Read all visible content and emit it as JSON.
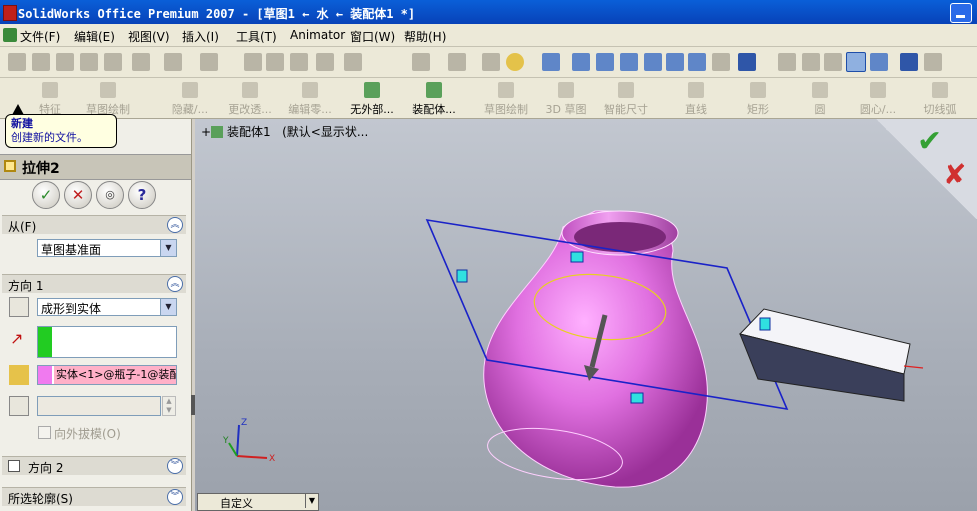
{
  "window": {
    "title": "SolidWorks Office Premium 2007 - [草图1 ← 水 ← 装配体1 *]"
  },
  "menu": [
    {
      "label": "文件(F)"
    },
    {
      "label": "编辑(E)"
    },
    {
      "label": "视图(V)"
    },
    {
      "label": "插入(I)"
    },
    {
      "label": "工具(T)"
    },
    {
      "label": "Animator"
    },
    {
      "label": "窗口(W)"
    },
    {
      "label": "帮助(H)"
    }
  ],
  "toolbar2": {
    "items": [
      "特征",
      "草图绘制",
      "隐藏/...",
      "更改透...",
      "编辑零...",
      "无外部...",
      "装配体...",
      "草图绘制",
      "3D 草图",
      "智能尺寸",
      "直线",
      "矩形",
      "圆",
      "圆心/...",
      "切线弧"
    ]
  },
  "tooltip": {
    "title": "新建",
    "desc": "创建新的文件。"
  },
  "feature_manager": {
    "root_label": "装配体1",
    "state": "(默认<显示状..."
  },
  "property_manager": {
    "title": "拉伸2",
    "from": {
      "label": "从(F)",
      "value": "草图基准面"
    },
    "dir1": {
      "label": "方向 1",
      "end_condition": "成形到实体",
      "body": "实体<1>@瓶子-1@装配",
      "draft_label": "向外拔模(O)"
    },
    "dir2": {
      "label": "方向 2"
    },
    "contours": {
      "label": "所选轮廓(S)"
    }
  },
  "view": {
    "bottom_combo": "自定义"
  },
  "colors": {
    "titlebar": "#0a5fd8",
    "bottle": "#d060d0",
    "sketch": "#1a22c8"
  }
}
